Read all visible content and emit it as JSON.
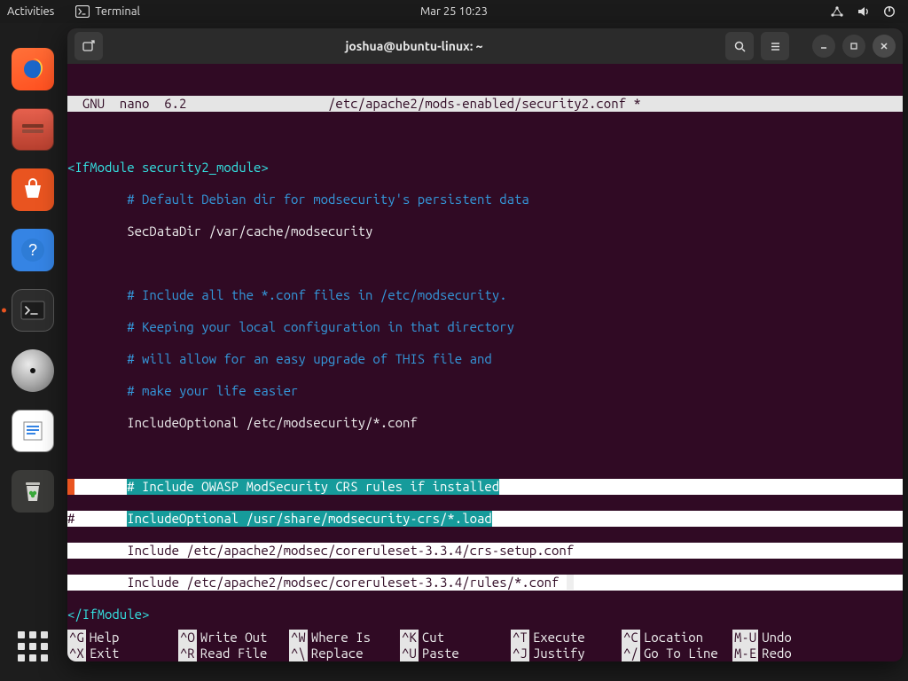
{
  "panel": {
    "activities": "Activities",
    "app_name": "Terminal",
    "datetime": "Mar 25  10:23"
  },
  "dock": {
    "items": [
      "firefox",
      "files",
      "software",
      "help",
      "terminal",
      "disc",
      "text",
      "trash"
    ]
  },
  "window": {
    "title": "joshua@ubuntu-linux: ~"
  },
  "nano": {
    "version": "GNU  nano  6.2",
    "file": "/etc/apache2/mods-enabled/security2.conf *",
    "lines": {
      "ifopen": "<IfModule security2_module>",
      "c1": "# Default Debian dir for modsecurity's persistent data",
      "l1": "SecDataDir /var/cache/modsecurity",
      "c2": "# Include all the *.conf files in /etc/modsecurity.",
      "c3": "# Keeping your local configuration in that directory",
      "c4": "# will allow for an easy upgrade of THIS file and",
      "c5": "# make your life easier",
      "l2": "IncludeOptional /etc/modsecurity/*.conf",
      "sel_c": "# Include OWASP ModSecurity CRS rules if installed",
      "sel_hash": "#",
      "sel_inc": "IncludeOptional /usr/share/modsecurity-crs/*.load",
      "l3": "Include /etc/apache2/modsec/coreruleset-3.3.4/crs-setup.conf",
      "l4": "Include /etc/apache2/modsec/coreruleset-3.3.4/rules/*.conf",
      "ifclose": "</IfModule>"
    },
    "help": [
      [
        [
          "^G",
          "Help"
        ],
        [
          "^O",
          "Write Out"
        ],
        [
          "^W",
          "Where Is"
        ],
        [
          "^K",
          "Cut"
        ],
        [
          "^T",
          "Execute"
        ],
        [
          "^C",
          "Location"
        ],
        [
          "M-U",
          "Undo"
        ]
      ],
      [
        [
          "^X",
          "Exit"
        ],
        [
          "^R",
          "Read File"
        ],
        [
          "^\\",
          "Replace"
        ],
        [
          "^U",
          "Paste"
        ],
        [
          "^J",
          "Justify"
        ],
        [
          "^/",
          "Go To Line"
        ],
        [
          "M-E",
          "Redo"
        ]
      ]
    ]
  }
}
